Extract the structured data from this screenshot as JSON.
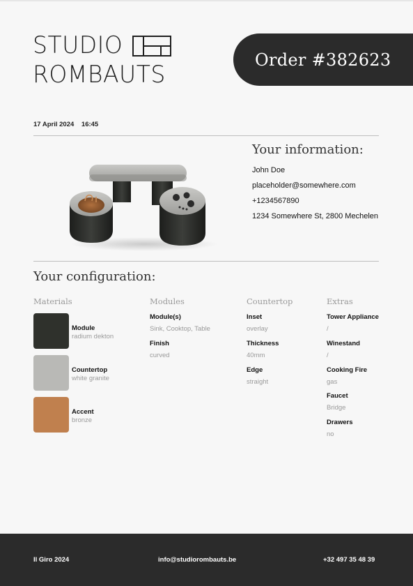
{
  "brand": {
    "line1": "STUDIO",
    "line2": "ROMBAUTS"
  },
  "order": {
    "label": "Order #382623"
  },
  "meta": {
    "date": "17 April 2024",
    "time": "16:45"
  },
  "customer": {
    "heading": "Your information:",
    "name": "John Doe",
    "email": "placeholder@somewhere.com",
    "phone": "+1234567890",
    "address": "1234 Somewhere St, 2800 Mechelen"
  },
  "configuration": {
    "heading": "Your configuration:",
    "columns": {
      "materials": "Materials",
      "modules": "Modules",
      "countertop": "Countertop",
      "extras": "Extras"
    },
    "materials": [
      {
        "label": "Module",
        "value": "radium dekton",
        "color": "#2f312c"
      },
      {
        "label": "Countertop",
        "value": "white granite",
        "color": "#b9b9b6"
      },
      {
        "label": "Accent",
        "value": "bronze",
        "color": "#c0804e"
      }
    ],
    "modules": [
      {
        "label": "Module(s)",
        "value": "Sink, Cooktop, Table"
      },
      {
        "label": "Finish",
        "value": "curved"
      }
    ],
    "countertop": [
      {
        "label": "Inset",
        "value": "overlay"
      },
      {
        "label": "Thickness",
        "value": "40mm"
      },
      {
        "label": "Edge",
        "value": "straight"
      }
    ],
    "extras": [
      {
        "label": "Tower Appliance",
        "value": "/"
      },
      {
        "label": "Winestand",
        "value": "/"
      },
      {
        "label": "Cooking Fire",
        "value": "gas"
      },
      {
        "label": "Faucet",
        "value": "Bridge"
      },
      {
        "label": "Drawers",
        "value": "no"
      }
    ]
  },
  "footer": {
    "left": "Il Giro 2024",
    "center": "info@studiorombauts.be",
    "right": "+32 497 35 48 39"
  }
}
